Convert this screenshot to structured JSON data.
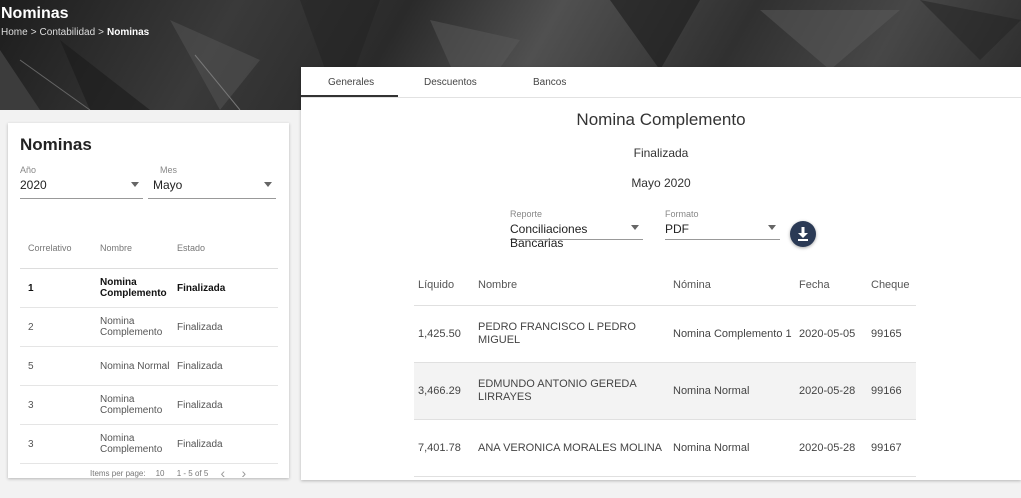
{
  "header": {
    "title": "Nominas",
    "breadcrumb": [
      "Home",
      "Contabilidad",
      "Nominas"
    ]
  },
  "left_panel": {
    "title": "Nominas",
    "year": {
      "label": "Año",
      "value": "2020"
    },
    "month": {
      "label": "Mes",
      "value": "Mayo"
    },
    "columns": [
      "Correlativo",
      "Nombre",
      "Estado"
    ],
    "rows": [
      {
        "correlativo": "1",
        "nombre": "Nomina Complemento",
        "estado": "Finalizada",
        "selected": true
      },
      {
        "correlativo": "2",
        "nombre": "Nomina Complemento",
        "estado": "Finalizada",
        "selected": false
      },
      {
        "correlativo": "5",
        "nombre": "Nomina Normal",
        "estado": "Finalizada",
        "selected": false
      },
      {
        "correlativo": "3",
        "nombre": "Nomina Complemento",
        "estado": "Finalizada",
        "selected": false
      },
      {
        "correlativo": "3",
        "nombre": "Nomina Complemento",
        "estado": "Finalizada",
        "selected": false
      }
    ],
    "paginator": {
      "items_per_page_label": "Items per page:",
      "items_per_page": "10",
      "range": "1 - 5 of 5"
    }
  },
  "main": {
    "tabs": [
      "Generales",
      "Descuentos",
      "Bancos"
    ],
    "active_tab": "Generales",
    "title": "Nomina Complemento",
    "status": "Finalizada",
    "period": "Mayo 2020",
    "report": {
      "label": "Reporte",
      "value": "Conciliaciones Bancarias"
    },
    "format": {
      "label": "Formato",
      "value": "PDF"
    },
    "columns": [
      "Líquido",
      "Nombre",
      "Nómina",
      "Fecha",
      "Cheque"
    ],
    "rows": [
      {
        "liquido": "1,425.50",
        "nombre": "PEDRO FRANCISCO L PEDRO MIGUEL",
        "nomina": "Nomina Complemento 1",
        "fecha": "2020-05-05",
        "cheque": "99165"
      },
      {
        "liquido": "3,466.29",
        "nombre": "EDMUNDO ANTONIO GEREDA LIRRAYES",
        "nomina": "Nomina Normal",
        "fecha": "2020-05-28",
        "cheque": "99166"
      },
      {
        "liquido": "7,401.78",
        "nombre": "ANA VERONICA MORALES MOLINA",
        "nomina": "Nomina Normal",
        "fecha": "2020-05-28",
        "cheque": "99167"
      }
    ]
  },
  "icons": {
    "download": "download-icon",
    "prev": "chevron-left-icon",
    "next": "chevron-right-icon"
  },
  "colors": {
    "accent": "#2b3a55"
  }
}
